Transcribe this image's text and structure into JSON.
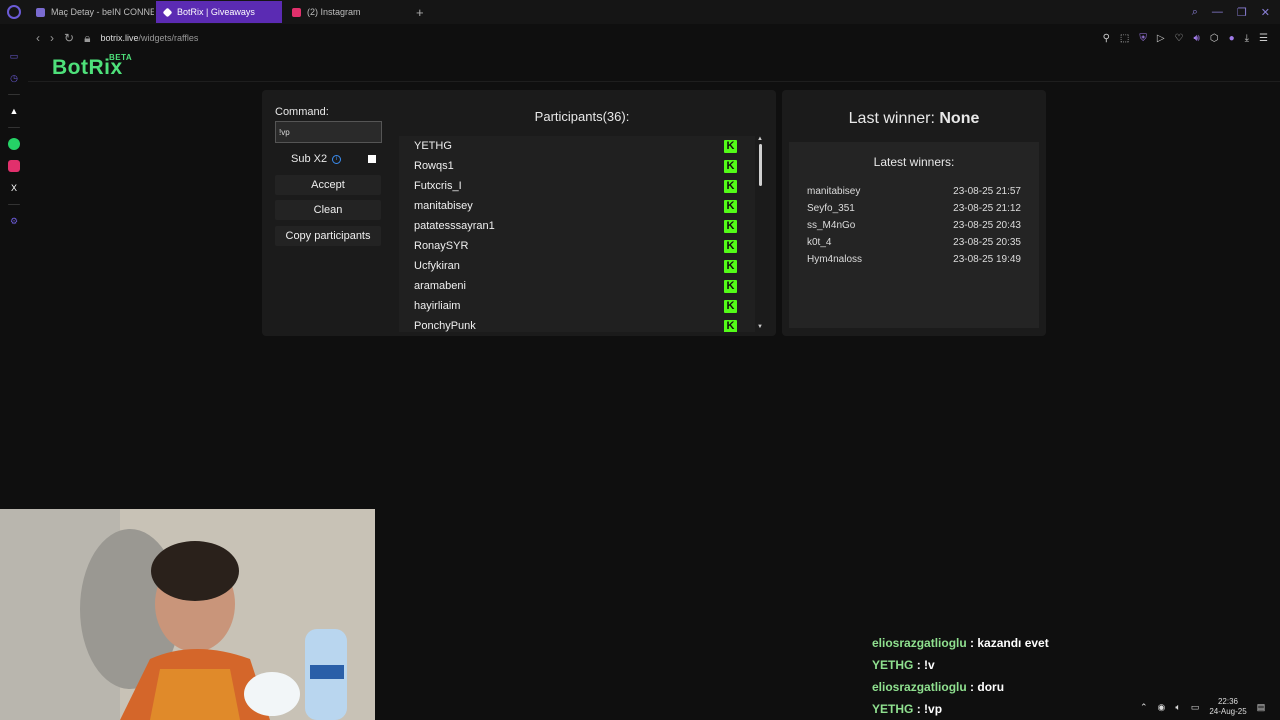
{
  "tabs": [
    {
      "title": "Maç Detay - beIN CONNE",
      "favicon_color": "#7a6bd0"
    },
    {
      "title": "BotRix | Giveaways",
      "favicon_color": "#ffffff"
    },
    {
      "title": "(2) Instagram",
      "favicon_color": "#e1306c"
    }
  ],
  "address": {
    "domain": "botrix.live",
    "path": "/widgets/raffles"
  },
  "brand": {
    "name": "BotRix",
    "badge": "BETA"
  },
  "raffle": {
    "command_label": "Command:",
    "command_value": "!vp",
    "sub_label": "Sub X2",
    "sub_checked": true,
    "accept_label": "Accept",
    "clean_label": "Clean",
    "copy_label": "Copy participants"
  },
  "participants": {
    "title": "Participants(36):",
    "items": [
      "YETHG",
      "Rowqs1",
      "Futxcris_I",
      "manitabisey",
      "patatesssayran1",
      "RonaySYR",
      "Ucfykiran",
      "aramabeni",
      "hayirliaim",
      "PonchyPunk"
    ],
    "platform_icon": "kick-icon",
    "accent": "#53fc18"
  },
  "last_winner": {
    "label": "Last winner:",
    "value": "None"
  },
  "latest_winners": {
    "title": "Latest winners:",
    "rows": [
      {
        "name": "manitabisey",
        "date": "23-08-25 21:57"
      },
      {
        "name": "Seyfo_351",
        "date": "23-08-25 21:12"
      },
      {
        "name": "ss_M4nGo",
        "date": "23-08-25 20:43"
      },
      {
        "name": "k0t_4",
        "date": "23-08-25 20:35"
      },
      {
        "name": "Hym4naloss",
        "date": "23-08-25 19:49"
      }
    ]
  },
  "chat": [
    {
      "user": "eliosrazgatlioglu",
      "text": ": kazandı evet"
    },
    {
      "user": "YETHG",
      "text": ": !v"
    },
    {
      "user": "eliosrazgatlioglu",
      "text": ": doru"
    },
    {
      "user": "YETHG",
      "text": ": !vp"
    }
  ],
  "clock": {
    "time": "22:36",
    "date": "24-Aug-25"
  }
}
